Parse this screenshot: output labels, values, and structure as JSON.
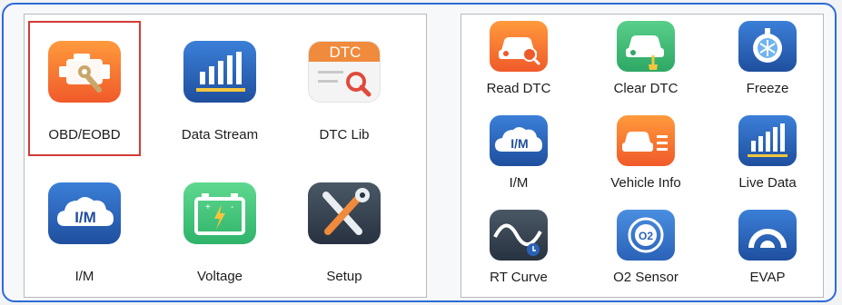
{
  "left_menu": {
    "items": [
      {
        "label": "OBD/EOBD",
        "icon": "engine-icon",
        "selected": true
      },
      {
        "label": "Data Stream",
        "icon": "bar-chart-icon"
      },
      {
        "label": "DTC Lib",
        "icon": "dtc-library-icon"
      },
      {
        "label": "I/M",
        "icon": "im-cloud-icon"
      },
      {
        "label": "Voltage",
        "icon": "battery-icon"
      },
      {
        "label": "Setup",
        "icon": "tools-icon"
      }
    ],
    "dtc_badge": "DTC",
    "im_badge": "I/M"
  },
  "right_menu": {
    "items": [
      {
        "label": "Read DTC",
        "icon": "car-search-icon"
      },
      {
        "label": "Clear DTC",
        "icon": "car-clean-icon"
      },
      {
        "label": "Freeze",
        "icon": "freeze-icon"
      },
      {
        "label": "I/M",
        "icon": "im-cloud-icon"
      },
      {
        "label": "Vehicle Info",
        "icon": "car-info-icon"
      },
      {
        "label": "Live Data",
        "icon": "bar-chart-icon"
      },
      {
        "label": "RT Curve",
        "icon": "curve-icon"
      },
      {
        "label": "O2 Sensor",
        "icon": "o2-sensor-icon"
      },
      {
        "label": "EVAP",
        "icon": "gauge-icon"
      }
    ],
    "im_badge": "I/M",
    "o2_badge": "O2"
  },
  "colors": {
    "frame_border": "#2e6bd6",
    "selection_border": "#d23b36",
    "orange": "#f05a2a",
    "blue": "#1f4f9e",
    "green": "#2ea865",
    "dark": "#283240"
  }
}
